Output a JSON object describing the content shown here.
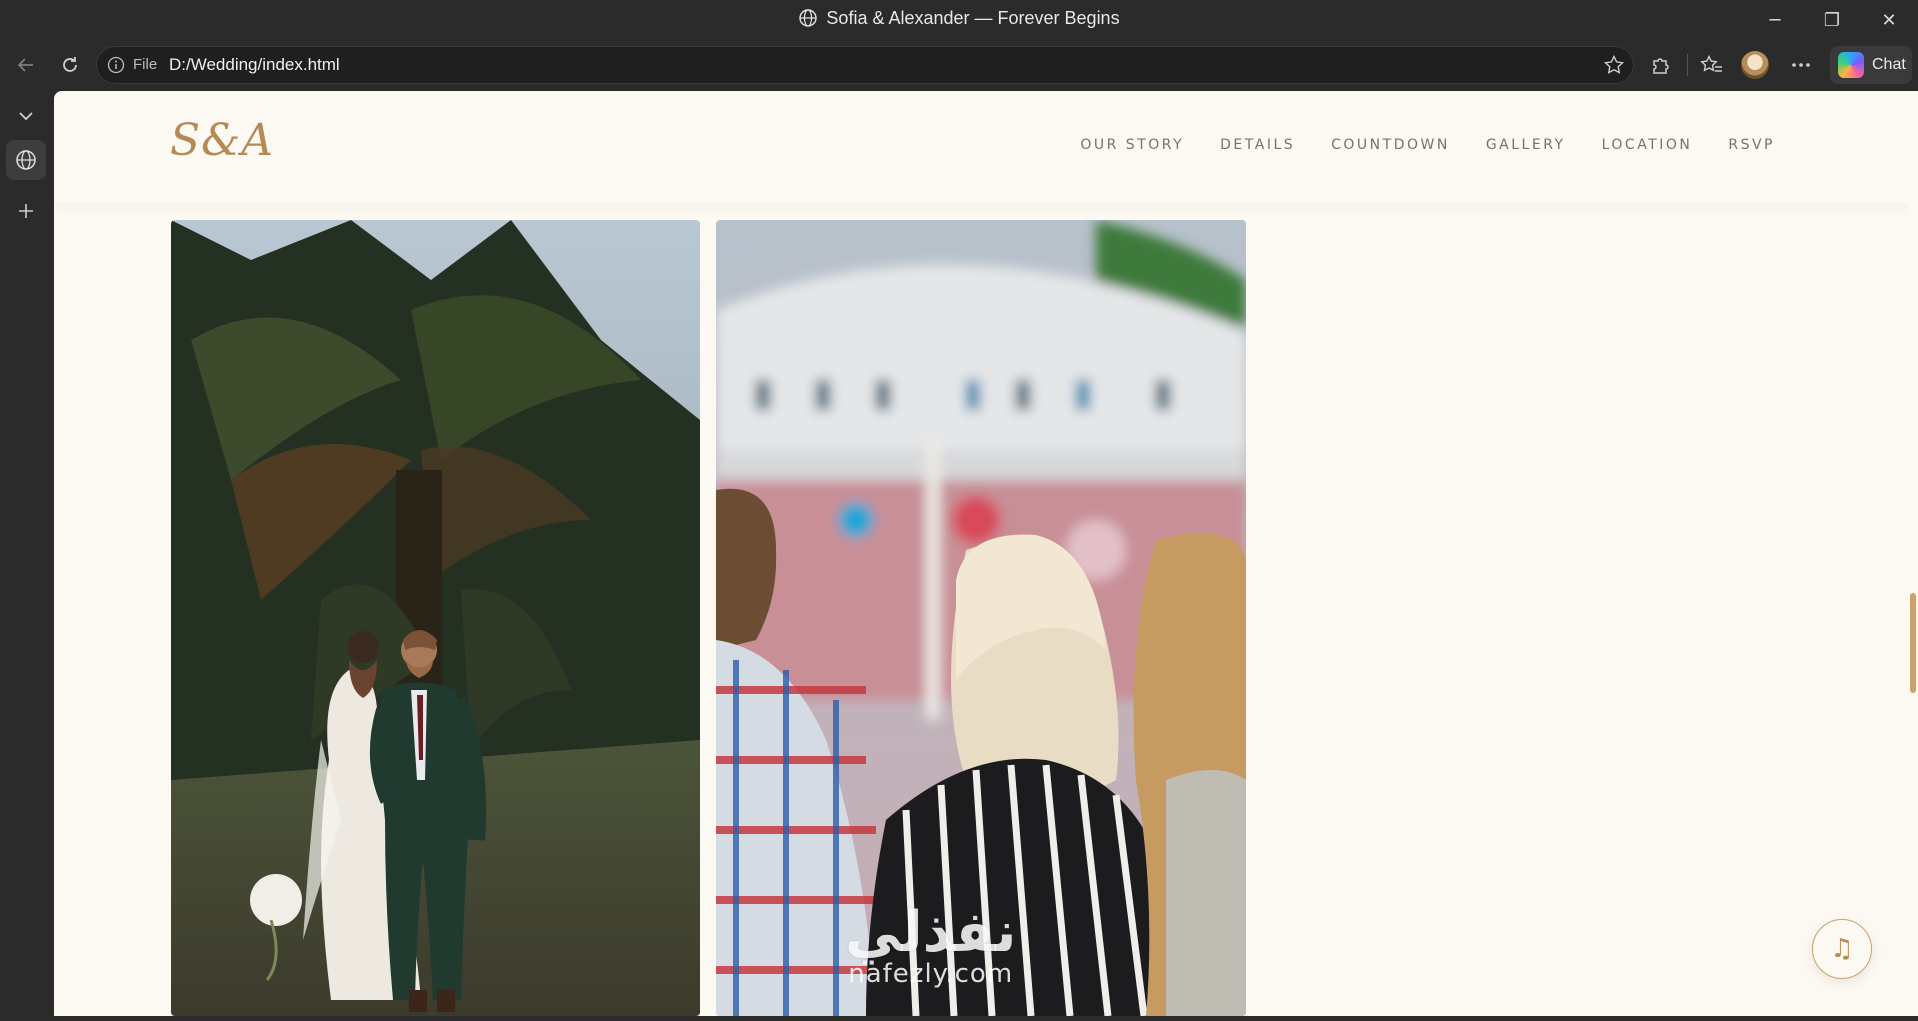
{
  "window": {
    "title": "Sofia & Alexander — Forever Begins",
    "controls": {
      "minimize": "─",
      "maximize": "❐",
      "close": "✕"
    }
  },
  "toolbar": {
    "address_label": "File",
    "url": "D:/Wedding/index.html",
    "chat_label": "Chat"
  },
  "site": {
    "logo": "S&A",
    "nav": [
      "OUR STORY",
      "DETAILS",
      "COUNTDOWN",
      "GALLERY",
      "LOCATION",
      "RSVP"
    ],
    "music_icon": "♫"
  },
  "watermark": {
    "arabic": "نفذلي",
    "latin": "nafezly.com"
  },
  "colors": {
    "accent": "#b58a55",
    "page_bg": "#fcf8f2",
    "nav_text": "#7a7168",
    "chrome_bg": "#2b2b2b"
  }
}
